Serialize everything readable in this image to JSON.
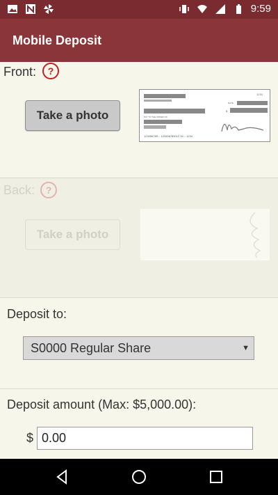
{
  "status_bar": {
    "time": "9:59"
  },
  "header": {
    "title": "Mobile Deposit"
  },
  "front": {
    "label": "Front:",
    "help": "?",
    "button": "Take a photo"
  },
  "back": {
    "label": "Back:",
    "help": "?",
    "button": "Take a photo"
  },
  "check_sample": {
    "number": "1234",
    "date_label": "DATE",
    "pay_label": "PAY TO THE ORDER OF",
    "amount_symbol": "$",
    "micr": "123456789 :: 123456789012 34 :: 1234"
  },
  "deposit_to": {
    "label": "Deposit to:",
    "selected": "S0000 Regular Share"
  },
  "amount": {
    "label": "Deposit amount (Max: $5,000.00):",
    "currency": "$",
    "value": "0.00"
  },
  "colors": {
    "status_bar": "#7a2b2f",
    "app_bar": "#8a3539",
    "help_icon": "#c41f1f",
    "page_bg": "#f6f6ea"
  }
}
